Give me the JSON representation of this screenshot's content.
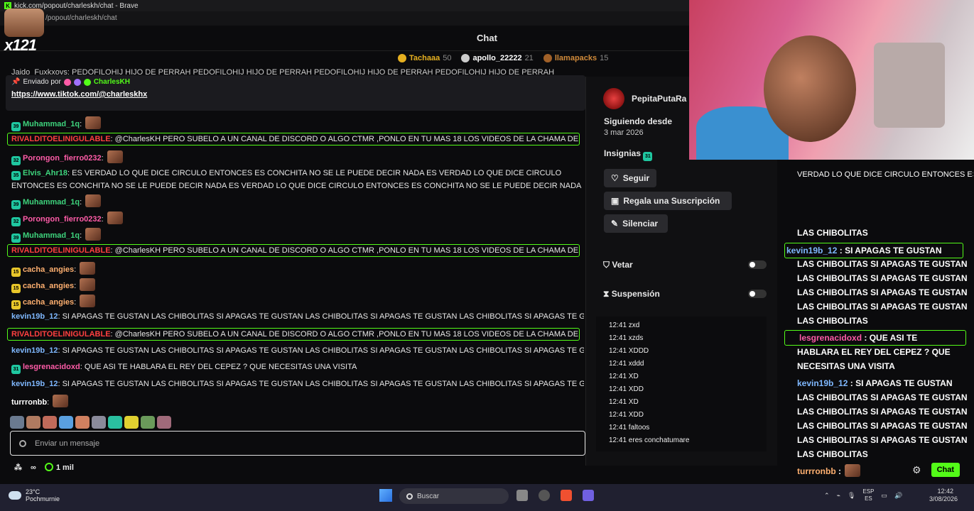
{
  "browser": {
    "title": "kick.com/popout/charleskh/chat - Brave",
    "url": "/popout/charleskh/chat"
  },
  "overlay_avatar": {
    "label": "x121"
  },
  "header": {
    "title": "Chat"
  },
  "top_gifters": [
    {
      "name": "Tachaaa",
      "count": "50"
    },
    {
      "name": "apollo_22222",
      "count": "21"
    },
    {
      "name": "llamapacks",
      "count": "15"
    }
  ],
  "scrolling_text": "Jaido_Fuxkxovs: PEDOFILOHIJ HIJO DE PERRAH PEDOFILOHIJ HIJO DE PERRAH PEDOFILOHIJ HIJO DE PERRAH PEDOFILOHIJ HIJO DE PERRAH",
  "pinned": {
    "sent_by": "Enviado por",
    "author": "CharlesKH",
    "link": "https://www.tiktok.com/@charleskhx"
  },
  "messages": [
    {
      "badge": "39",
      "user": "Muhammad_1q",
      "text": ""
    },
    {
      "user": "RIVALDITOELINIGULABLE",
      "text": "@CharlesKH PERO SUBELO A UN CANAL DE DISCORD O ALGO CTMR ,PONLO EN TU MAS 18 LOS VIDEOS DE LA CHAMA DEL"
    },
    {
      "badge": "32",
      "user": "Porongon_fierro0232",
      "text": ""
    },
    {
      "badge": "35",
      "user": "Elvis_Ahr18",
      "text": "ES VERDAD LO QUE DICE CIRCULO ENTONCES ES CONCHITA NO SE LE PUEDE DECIR NADA ES VERDAD LO QUE DICE CIRCULO ENTONCES ES CONCHITA NO SE LE PUEDE DECIR NADA ES VERDAD LO QUE DICE CIRCULO ENTONCES ES CONCHITA NO SE LE PUEDE DECIR NADA"
    },
    {
      "badge": "39",
      "user": "Muhammad_1q",
      "text": ""
    },
    {
      "badge": "32",
      "user": "Porongon_fierro0232",
      "text": ""
    },
    {
      "badge": "39",
      "user": "Muhammad_1q",
      "text": ""
    },
    {
      "user": "RIVALDITOELINIGULABLE",
      "text": "@CharlesKH PERO SUBELO A UN CANAL DE DISCORD O ALGO CTMR ,PONLO EN TU MAS 18 LOS VIDEOS DE LA CHAMA DEL"
    },
    {
      "badge": "15",
      "user": "cacha_angies",
      "text": ""
    },
    {
      "badge": "15",
      "user": "cacha_angies",
      "text": ""
    },
    {
      "badge": "15",
      "user": "cacha_angies",
      "text": ""
    },
    {
      "user": "kevin19b_12",
      "text": "SI APAGAS TE GUSTAN LAS CHIBOLITAS SI APAGAS TE GUSTAN LAS CHIBOLITAS SI APAGAS TE GUSTAN LAS CHIBOLITAS SI APAGAS TE GUSTAN"
    },
    {
      "user": "RIVALDITOELINIGULABLE",
      "text": "@CharlesKH PERO SUBELO A UN CANAL DE DISCORD O ALGO CTMR ,PONLO EN TU MAS 18 LOS VIDEOS DE LA CHAMA DEL"
    },
    {
      "user": "kevin19b_12",
      "text": "SI APAGAS TE GUSTAN LAS CHIBOLITAS SI APAGAS TE GUSTAN LAS CHIBOLITAS SI APAGAS TE GUSTAN LAS CHIBOLITAS SI APAGAS TE GU"
    },
    {
      "badge": "31",
      "user": "lesgrenacidoxd",
      "text": "QUE ASI TE HABLARA EL REY DEL CEPEZ ? QUE NECESITAS UNA VISITA"
    },
    {
      "user": "kevin19b_12",
      "text": "SI APAGAS TE GUSTAN LAS CHIBOLITAS SI APAGAS TE GUSTAN LAS CHIBOLITAS SI APAGAS TE GUSTAN LAS CHIBOLITAS SI APAGAS TE GU"
    },
    {
      "user": "turrronbb",
      "text": ""
    }
  ],
  "input": {
    "placeholder": "Enviar un mensaje"
  },
  "bottom": {
    "infinity": "∞",
    "viewers": "1 mil"
  },
  "user_card": {
    "name": "PepitaPutaRa",
    "following_label": "Siguiendo desde",
    "following_date": "3 mar 2026",
    "badges_label": "Insignias",
    "badge_value": "31",
    "follow": "Seguir",
    "gift": "Regala una Suscripción",
    "mute": "Silenciar",
    "ban": "Vetar",
    "timeout": "Suspensión",
    "history": [
      "12:41 zxd",
      "12:41 xzds",
      "12:41 XDDD",
      "12:41 xddd",
      "12:41 XD",
      "12:41 XDD",
      "12:41 XD",
      "12:41 XDD",
      "12:41 faltoos",
      "12:41 eres conchatumare"
    ]
  },
  "right_chat": {
    "overflow_top": "VERDAD LO QUE DICE CIRCULO ENTONCES ES",
    "lines": [
      {
        "text": "LAS CHIBOLITAS"
      },
      {
        "user": "kevin19b_12",
        "text": "SI APAGAS TE GUSTAN"
      },
      {
        "text": "LAS CHIBOLITAS SI APAGAS TE GUSTAN"
      },
      {
        "text": "LAS CHIBOLITAS SI APAGAS TE GUSTAN"
      },
      {
        "text": "LAS CHIBOLITAS SI APAGAS TE GUSTAN"
      },
      {
        "text": "LAS CHIBOLITAS SI APAGAS TE GUSTAN"
      },
      {
        "text": "LAS CHIBOLITAS"
      },
      {
        "user": "lesgrenacidoxd",
        "text": "QUE ASI TE"
      },
      {
        "text": "HABLARA EL REY DEL CEPEZ ? QUE"
      },
      {
        "text": "NECESITAS UNA VISITA"
      },
      {
        "user": "kevin19b_12",
        "text": "SI APAGAS TE GUSTAN"
      },
      {
        "text": "LAS CHIBOLITAS SI APAGAS TE GUSTAN"
      },
      {
        "text": "LAS CHIBOLITAS SI APAGAS TE GUSTAN"
      },
      {
        "text": "LAS CHIBOLITAS SI APAGAS TE GUSTAN"
      },
      {
        "text": "LAS CHIBOLITAS SI APAGAS TE GUSTAN"
      },
      {
        "text": "LAS CHIBOLITAS"
      },
      {
        "user": "turrronbb",
        "text": ""
      }
    ],
    "chat_button": "Chat"
  },
  "taskbar": {
    "temp": "23°C",
    "location": "Pochmurnie",
    "search": "Buscar",
    "lang1": "ESP",
    "lang2": "ES",
    "time": "12:42",
    "date": "3/08/2026"
  },
  "colors": {
    "accent": "#53fc18",
    "background": "#0b0b0d"
  }
}
